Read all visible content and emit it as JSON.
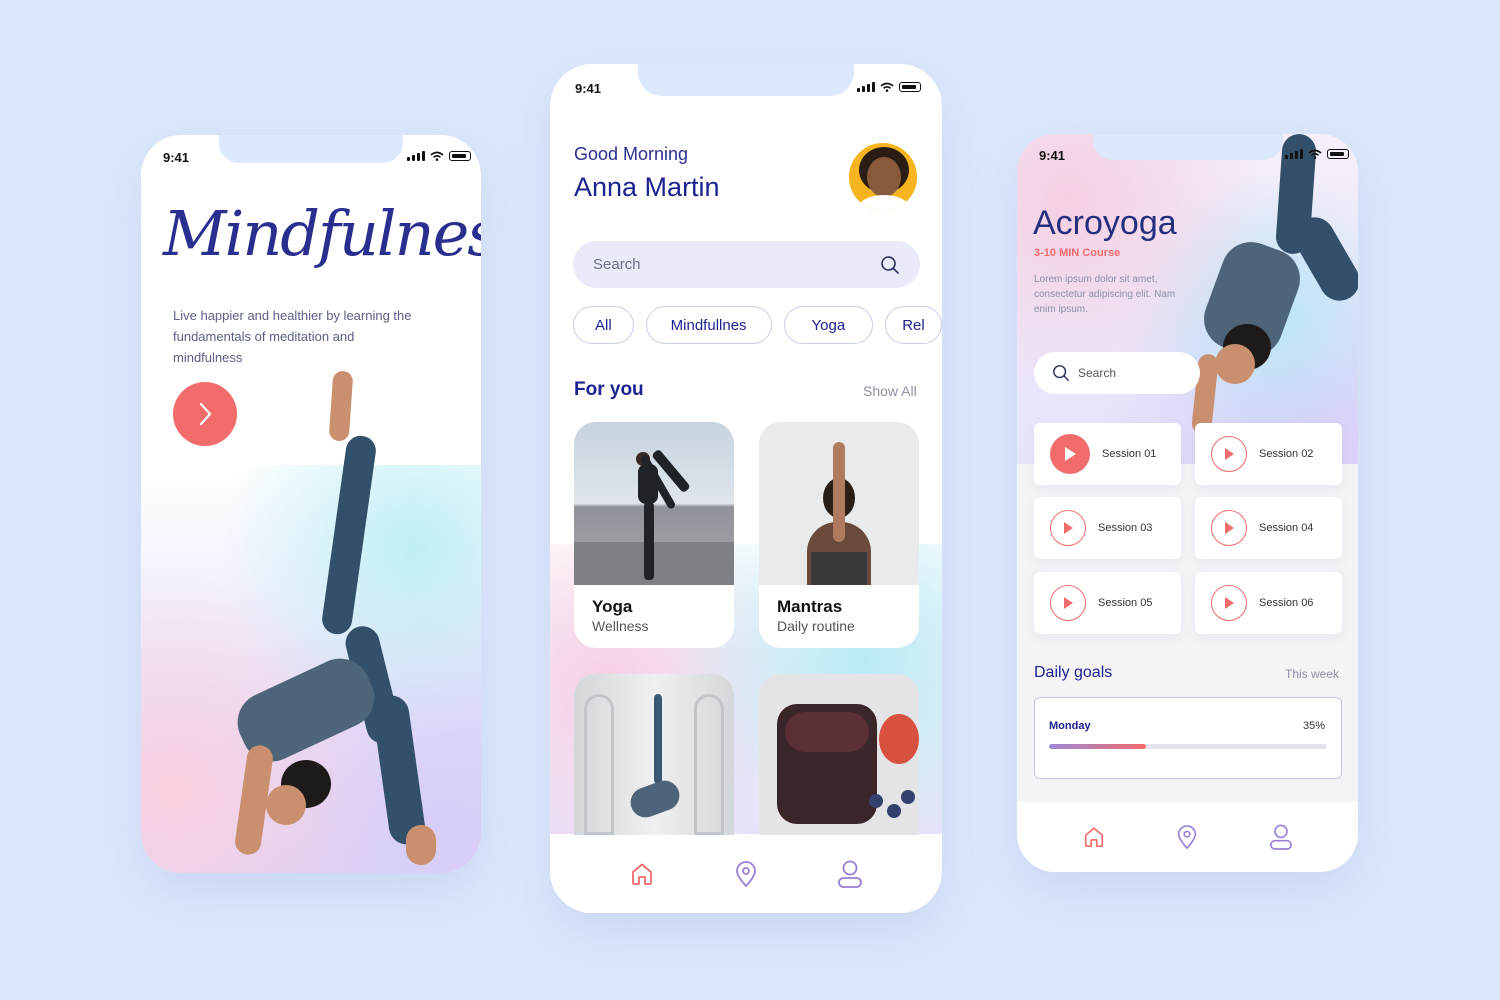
{
  "colors": {
    "background": "#dce8fb",
    "accent": "#f36c6c",
    "navy": "#1c2290"
  },
  "onboarding": {
    "status_time": "9:41",
    "title": "Mindfulness",
    "description": "Live happier and healthier by learning the fundamentals of meditation and mindfulness",
    "next_icon": "chevron-right-icon"
  },
  "home": {
    "status_time": "9:41",
    "greeting": "Good Morning",
    "user_name": "Anna Martin",
    "search_placeholder": "Search",
    "chips": [
      "All",
      "Mindfullnes",
      "Yoga",
      "Rel"
    ],
    "section_title": "For you",
    "show_all": "Show All",
    "cards": [
      {
        "title": "Yoga",
        "subtitle": "Wellness"
      },
      {
        "title": "Mantras",
        "subtitle": "Daily routine"
      }
    ],
    "tabs": [
      "home-icon",
      "location-icon",
      "profile-icon"
    ]
  },
  "course": {
    "status_time": "9:41",
    "title": "Acroyoga",
    "duration": "3-10 MIN Course",
    "description": "Lorem ipsum dolor sit amet, consectetur adipiscing elit. Nam enim ipsum.",
    "search_placeholder": "Search",
    "sessions": [
      "Session 01",
      "Session 02",
      "Session 03",
      "Session 04",
      "Session 05",
      "Session 06"
    ],
    "daily_goals_title": "Daily goals",
    "period": "This week",
    "goal": {
      "day": "Monday",
      "percent_label": "35%",
      "progress": 0.35
    },
    "tabs": [
      "home-icon",
      "location-icon",
      "profile-icon"
    ]
  }
}
